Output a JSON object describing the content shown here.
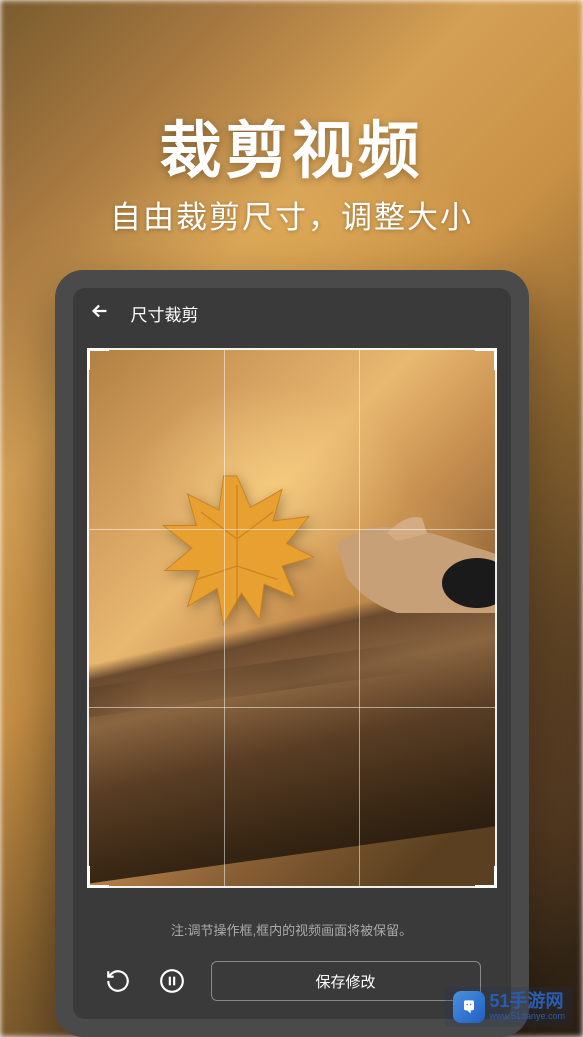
{
  "hero": {
    "title": "裁剪视频",
    "subtitle": "自由裁剪尺寸，调整大小"
  },
  "app": {
    "header_title": "尺寸裁剪",
    "hint_text": "注:调节操作框,框内的视频画面将被保留。",
    "save_button_label": "保存修改"
  },
  "watermark": {
    "brand": "51手游网",
    "url": "www.51danye.com"
  }
}
